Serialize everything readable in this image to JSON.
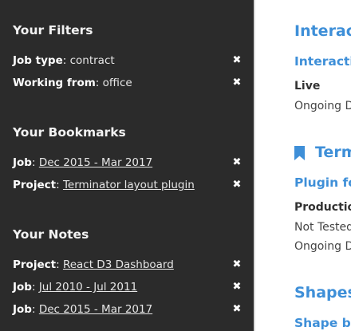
{
  "sidebar": {
    "filters": {
      "title": "Your Filters",
      "items": [
        {
          "key": "Job type",
          "sep": ":",
          "value": "contract"
        },
        {
          "key": "Working from",
          "sep": ":",
          "value": "office"
        }
      ]
    },
    "bookmarks": {
      "title": "Your Bookmarks",
      "items": [
        {
          "key": "Job",
          "sep": ":",
          "value": "Dec 2015 - Mar 2017"
        },
        {
          "key": "Project",
          "sep": ":",
          "value": "Terminator layout plugin"
        }
      ]
    },
    "notes": {
      "title": "Your Notes",
      "items": [
        {
          "key": "Project",
          "sep": ":",
          "value": "React D3 Dashboard"
        },
        {
          "key": "Job",
          "sep": ":",
          "value": "Jul 2010 - Jul 2011"
        },
        {
          "key": "Job",
          "sep": ":",
          "value": "Dec 2015 - Mar 2017"
        }
      ]
    },
    "remove_glyph": "✖"
  },
  "main": {
    "entries": [
      {
        "title": "Interact",
        "subtitle": "Interactiv",
        "label": "Live",
        "lines": [
          "Ongoing D"
        ]
      },
      {
        "title": "Term",
        "subtitle": "Plugin for",
        "label": "Production",
        "lines": [
          "Not Tested",
          "Ongoing D"
        ],
        "icon": "bookmark-icon"
      },
      {
        "title": "Shapes",
        "subtitle": "Shape ba"
      }
    ],
    "accent_color": "#3e8fd8"
  }
}
